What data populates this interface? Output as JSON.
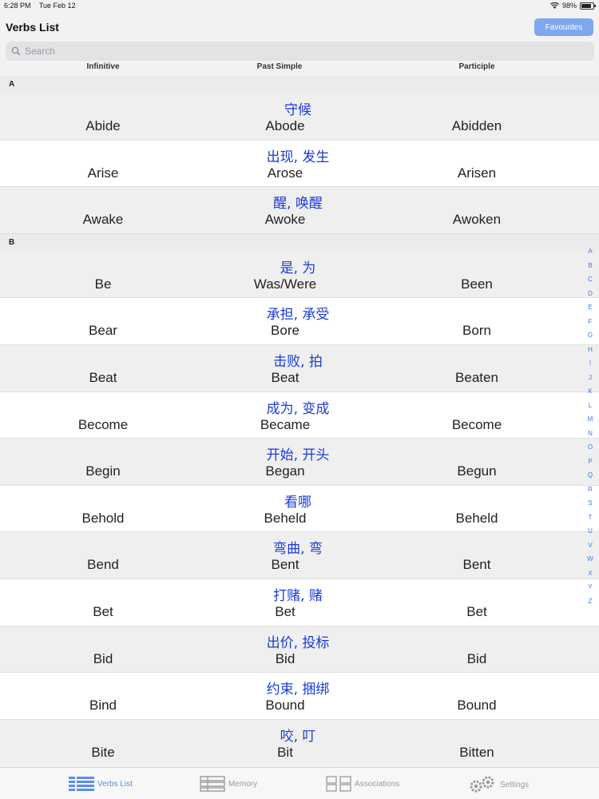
{
  "status": {
    "time": "6:28 PM",
    "date": "Tue Feb 12",
    "battery": "98%"
  },
  "header": {
    "title": "Verbs List",
    "favourites_label": "Favourites"
  },
  "search": {
    "placeholder": "Search",
    "value": ""
  },
  "columns": {
    "infinitive": "Infinitive",
    "past_simple": "Past Simple",
    "participle": "Participle"
  },
  "sections": [
    {
      "letter": "A",
      "rows": [
        {
          "translation": "守候",
          "infinitive": "Abide",
          "past": "Abode",
          "participle": "Abidden"
        },
        {
          "translation": "出现, 发生",
          "infinitive": "Arise",
          "past": "Arose",
          "participle": "Arisen"
        },
        {
          "translation": "醒, 唤醒",
          "infinitive": "Awake",
          "past": "Awoke",
          "participle": "Awoken"
        }
      ]
    },
    {
      "letter": "B",
      "rows": [
        {
          "translation": "是, 为",
          "infinitive": "Be",
          "past": "Was/Were",
          "participle": "Been"
        },
        {
          "translation": "承担, 承受",
          "infinitive": "Bear",
          "past": "Bore",
          "participle": "Born"
        },
        {
          "translation": "击败, 拍",
          "infinitive": "Beat",
          "past": "Beat",
          "participle": "Beaten"
        },
        {
          "translation": "成为, 变成",
          "infinitive": "Become",
          "past": "Became",
          "participle": "Become"
        },
        {
          "translation": "开始, 开头",
          "infinitive": "Begin",
          "past": "Began",
          "participle": "Begun"
        },
        {
          "translation": "看哪",
          "infinitive": "Behold",
          "past": "Beheld",
          "participle": "Beheld"
        },
        {
          "translation": "弯曲, 弯",
          "infinitive": "Bend",
          "past": "Bent",
          "participle": "Bent"
        },
        {
          "translation": "打赌, 赌",
          "infinitive": "Bet",
          "past": "Bet",
          "participle": "Bet"
        },
        {
          "translation": "出价, 投标",
          "infinitive": "Bid",
          "past": "Bid",
          "participle": "Bid"
        },
        {
          "translation": "约束, 捆绑",
          "infinitive": "Bind",
          "past": "Bound",
          "participle": "Bound"
        },
        {
          "translation": "咬, 叮",
          "infinitive": "Bite",
          "past": "Bit",
          "participle": "Bitten"
        }
      ]
    }
  ],
  "index_letters": [
    "A",
    "B",
    "C",
    "D",
    "E",
    "F",
    "G",
    "H",
    "I",
    "J",
    "K",
    "L",
    "M",
    "N",
    "O",
    "P",
    "Q",
    "R",
    "S",
    "T",
    "U",
    "V",
    "W",
    "X",
    "Y",
    "Z"
  ],
  "tabs": [
    {
      "label": "Verbs List",
      "icon": "list-icon",
      "active": true
    },
    {
      "label": "Memory",
      "icon": "memory-icon",
      "active": false
    },
    {
      "label": "Associations",
      "icon": "associations-icon",
      "active": false
    },
    {
      "label": "Settings",
      "icon": "gear-icon",
      "active": false
    }
  ],
  "colors": {
    "accent": "#5b8cf0",
    "translation": "#1a3bd6",
    "button": "#7fa7ee"
  }
}
